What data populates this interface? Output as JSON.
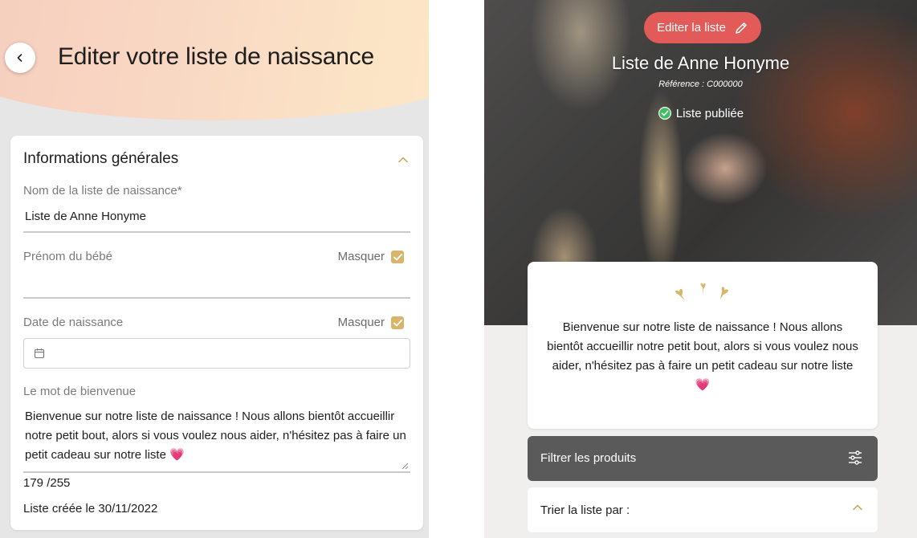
{
  "editor": {
    "title": "Editer votre liste de naissance",
    "section_title": "Informations générales",
    "fields": {
      "list_name_label": "Nom de la liste de naissance*",
      "list_name_value": "Liste de Anne Honyme",
      "baby_name_label": "Prénom du bébé",
      "baby_name_value": "",
      "birth_date_label": "Date de naissance",
      "birth_date_value": "",
      "welcome_label": "Le mot de bienvenue",
      "welcome_value": "Bienvenue sur notre liste de naissance ! Nous allons bientôt accueillir notre petit bout, alors si vous voulez nous aider, n'hésitez pas à faire un petit cadeau sur notre liste 💗",
      "mask_label": "Masquer",
      "baby_name_masked": true,
      "birth_date_masked": true
    },
    "counter": "179 /255",
    "created": "Liste créée le 30/11/2022"
  },
  "preview": {
    "edit_button_label": "Editer la liste",
    "list_name": "Liste de Anne Honyme",
    "reference": "Référence : C000000",
    "status": "Liste publiée",
    "welcome_text": "Bienvenue sur notre liste de naissance ! Nous allons bientôt accueillir notre petit bout, alors si vous voulez nous aider, n'hésitez pas à faire un petit cadeau sur notre liste 💗",
    "filter_label": "Filtrer les produits",
    "sort_label": "Trier la liste par :"
  },
  "colors": {
    "accent_gold": "#d8b56a",
    "edit_button_red": "#e35b58",
    "status_green": "#3fbf62",
    "filter_bar": "#5a5a5a"
  },
  "icons": {
    "back": "chevron-left-icon",
    "collapse": "chevron-up-icon",
    "checkbox": "checkbox-checked-icon",
    "calendar": "calendar-icon",
    "edit": "pencil-icon",
    "status": "check-circle-icon",
    "decoration": "hearts-icon",
    "filter": "sliders-icon"
  }
}
